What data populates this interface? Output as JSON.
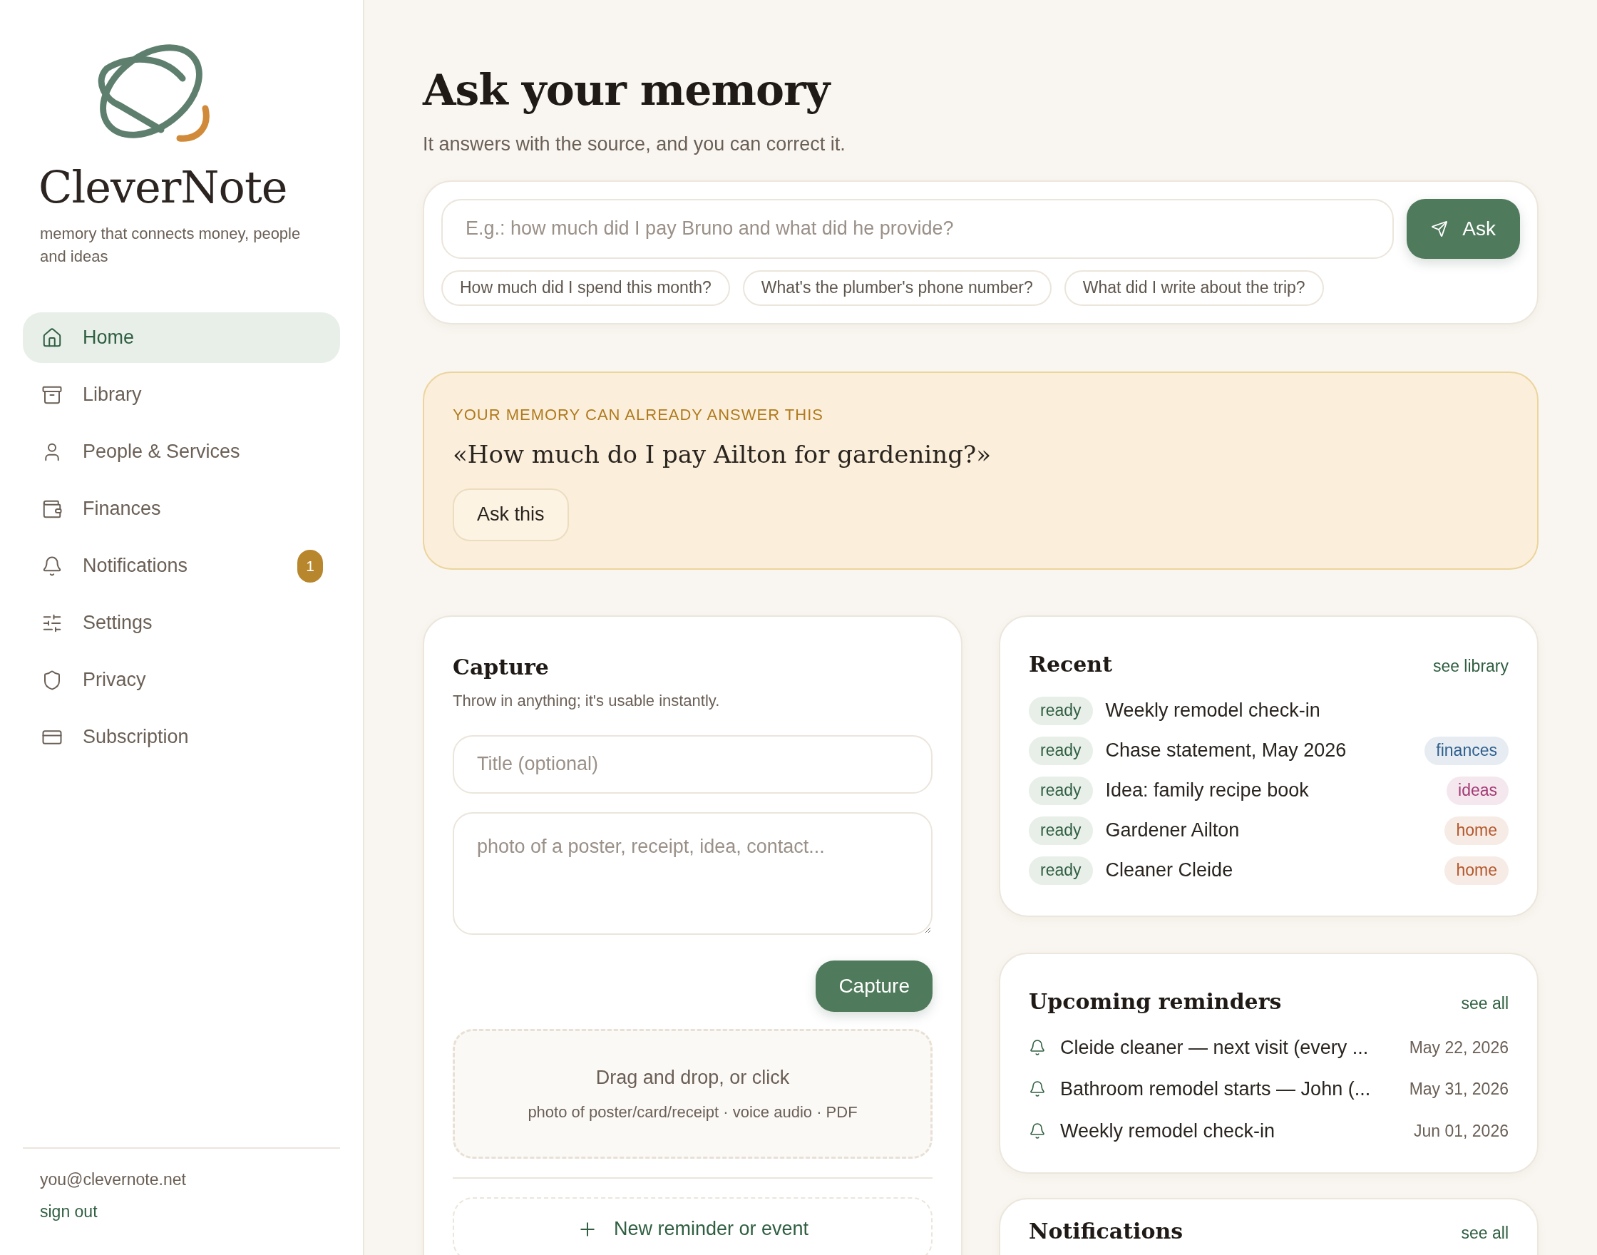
{
  "brand": {
    "name": "CleverNote",
    "tagline": "memory that connects money, people and ideas"
  },
  "nav": [
    {
      "label": "Home",
      "selected": true
    },
    {
      "label": "Library",
      "selected": false
    },
    {
      "label": "People & Services",
      "selected": false
    },
    {
      "label": "Finances",
      "selected": false
    },
    {
      "label": "Notifications",
      "selected": false,
      "badge": "1"
    },
    {
      "label": "Settings",
      "selected": false
    },
    {
      "label": "Privacy",
      "selected": false
    },
    {
      "label": "Subscription",
      "selected": false
    }
  ],
  "account": {
    "email": "you@clevernote.net",
    "sign_out": "sign out"
  },
  "header": {
    "title": "Ask your memory",
    "subtitle": "It answers with the source, and you can correct it."
  },
  "ask": {
    "placeholder": "E.g.: how much did I pay Bruno and what did he provide?",
    "button": "Ask",
    "suggestions": [
      "How much did I spend this month?",
      "What's the plumber's phone number?",
      "What did I write about the trip?"
    ]
  },
  "banner": {
    "eyebrow": "YOUR MEMORY CAN ALREADY ANSWER THIS",
    "question": "«How much do I pay Ailton for gardening?»",
    "button": "Ask this"
  },
  "capture": {
    "title": "Capture",
    "subtitle": "Throw in anything; it's usable instantly.",
    "title_placeholder": "Title (optional)",
    "body_placeholder": "photo of a poster, receipt, idea, contact...",
    "button": "Capture",
    "dropzone": {
      "title": "Drag and drop, or click",
      "hint": "photo of poster/card/receipt · voice audio · PDF"
    },
    "new_reminder": "New reminder or event"
  },
  "recent": {
    "title": "Recent",
    "link": "see library",
    "items": [
      {
        "status": "ready",
        "title": "Weekly remodel check-in"
      },
      {
        "status": "ready",
        "title": "Chase statement, May 2026",
        "tag": "finances",
        "color": "#2f5f8f"
      },
      {
        "status": "ready",
        "title": "Idea: family recipe book",
        "tag": "ideas",
        "color": "#a33a74"
      },
      {
        "status": "ready",
        "title": "Gardener Ailton",
        "tag": "home",
        "color": "#b4572a"
      },
      {
        "status": "ready",
        "title": "Cleaner Cleide",
        "tag": "home",
        "color": "#b4572a"
      }
    ]
  },
  "reminders": {
    "title": "Upcoming reminders",
    "link": "see all",
    "items": [
      {
        "title": "Cleide cleaner — next visit (every ...",
        "date": "May 22, 2026"
      },
      {
        "title": "Bathroom remodel starts — John (...",
        "date": "May 31, 2026"
      },
      {
        "title": "Weekly remodel check-in",
        "date": "Jun 01, 2026"
      }
    ]
  },
  "notifications": {
    "title": "Notifications",
    "link": "see all"
  }
}
